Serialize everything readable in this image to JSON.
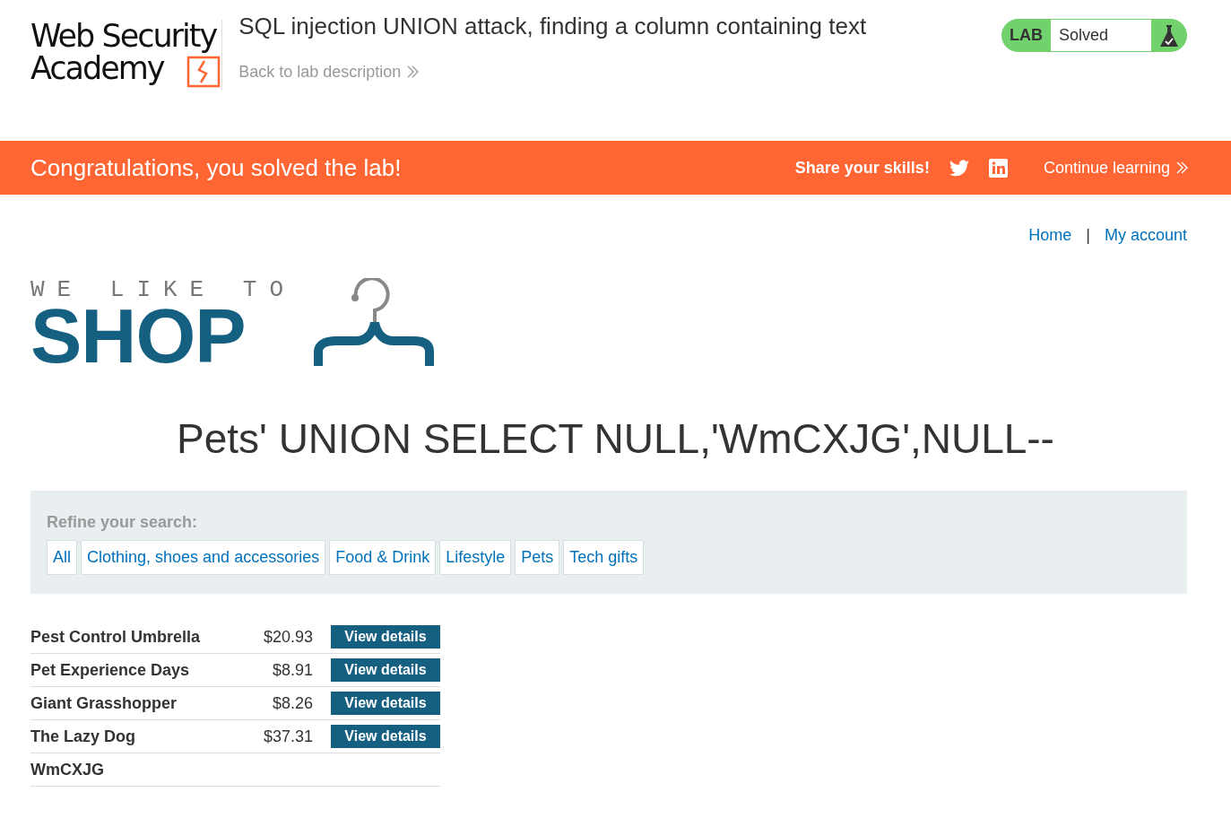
{
  "header": {
    "logo_lines": [
      "Web Security",
      "Academy"
    ],
    "title": "SQL injection UNION attack, finding a column containing text",
    "back_link": "Back to lab description",
    "lab_status": {
      "label": "LAB",
      "status": "Solved",
      "solved": true
    }
  },
  "banner": {
    "message": "Congratulations, you solved the lab!",
    "share_label": "Share your skills!",
    "continue_link": "Continue learning"
  },
  "nav": {
    "links": [
      "Home",
      "My account"
    ],
    "separator": "|"
  },
  "shop_logo": {
    "tagline": "WE LIKE TO",
    "word": "SHOP"
  },
  "search_heading": "Pets' UNION SELECT NULL,'WmCXJG',NULL--",
  "filters": {
    "label": "Refine your search:",
    "categories": [
      {
        "label": "All"
      },
      {
        "label": "Clothing, shoes and accessories"
      },
      {
        "label": "Food & Drink"
      },
      {
        "label": "Lifestyle"
      },
      {
        "label": "Pets"
      },
      {
        "label": "Tech gifts"
      }
    ]
  },
  "products": [
    {
      "name": "Pest Control Umbrella",
      "price": "$20.93",
      "button": "View details"
    },
    {
      "name": "Pet Experience Days",
      "price": "$8.91",
      "button": "View details"
    },
    {
      "name": "Giant Grasshopper",
      "price": "$8.26",
      "button": "View details"
    },
    {
      "name": "The Lazy Dog",
      "price": "$37.31",
      "button": "View details"
    },
    {
      "name": "WmCXJG"
    }
  ]
}
